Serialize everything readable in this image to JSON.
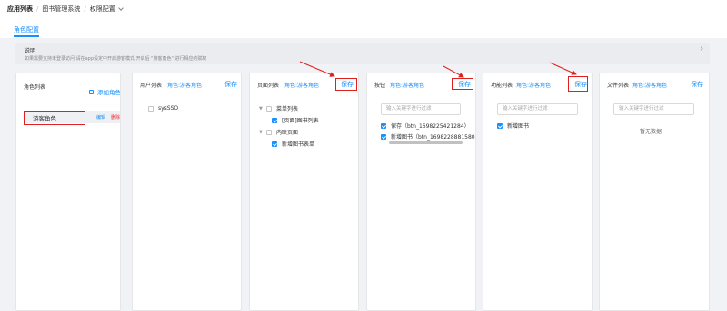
{
  "breadcrumb": [
    "应用列表",
    "图书管理系统",
    "权限配置"
  ],
  "tab": "角色配置",
  "notice": {
    "title": "说明",
    "text": "如果需要支持未登录访问,请在app设定中开启游客模式,开启后 \"游客角色\" 进行相应的赋权"
  },
  "role_panel": {
    "title": "角色列表",
    "add_label": "添加角色",
    "role_name": "游客角色",
    "edit_label": "编辑",
    "delete_label": "删除"
  },
  "user_panel": {
    "title": "用户列表",
    "subtitle": "角色:游客角色",
    "save_label": "保存",
    "users": [
      "sysSSO"
    ]
  },
  "page_panel": {
    "title": "页面列表",
    "subtitle": "角色:游客角色",
    "save_label": "保存",
    "menu_group": "菜单列表",
    "menu_item": "[页面]图书列表",
    "inline_group": "内联页面",
    "inline_item": "新增图书表单"
  },
  "button_panel": {
    "title": "按钮",
    "subtitle": "角色:游客角色",
    "save_label": "保存",
    "filter_placeholder": "输入关键字进行过滤",
    "items": [
      "保存（btn_1698225421284）",
      "新增图书（btn_1698228881580"
    ]
  },
  "function_panel": {
    "title": "功能列表",
    "subtitle": "角色:游客角色",
    "save_label": "保存",
    "filter_placeholder": "输入关键字进行过滤",
    "items": [
      "新增图书"
    ]
  },
  "file_panel": {
    "title": "文件列表",
    "subtitle": "角色:游客角色",
    "save_label": "保存",
    "filter_placeholder": "输入关键字进行过滤",
    "empty_text": "暂无数据"
  },
  "colors": {
    "accent": "#1890ff",
    "annotation_red": "#e0201e",
    "background": "#f0f2f5"
  }
}
